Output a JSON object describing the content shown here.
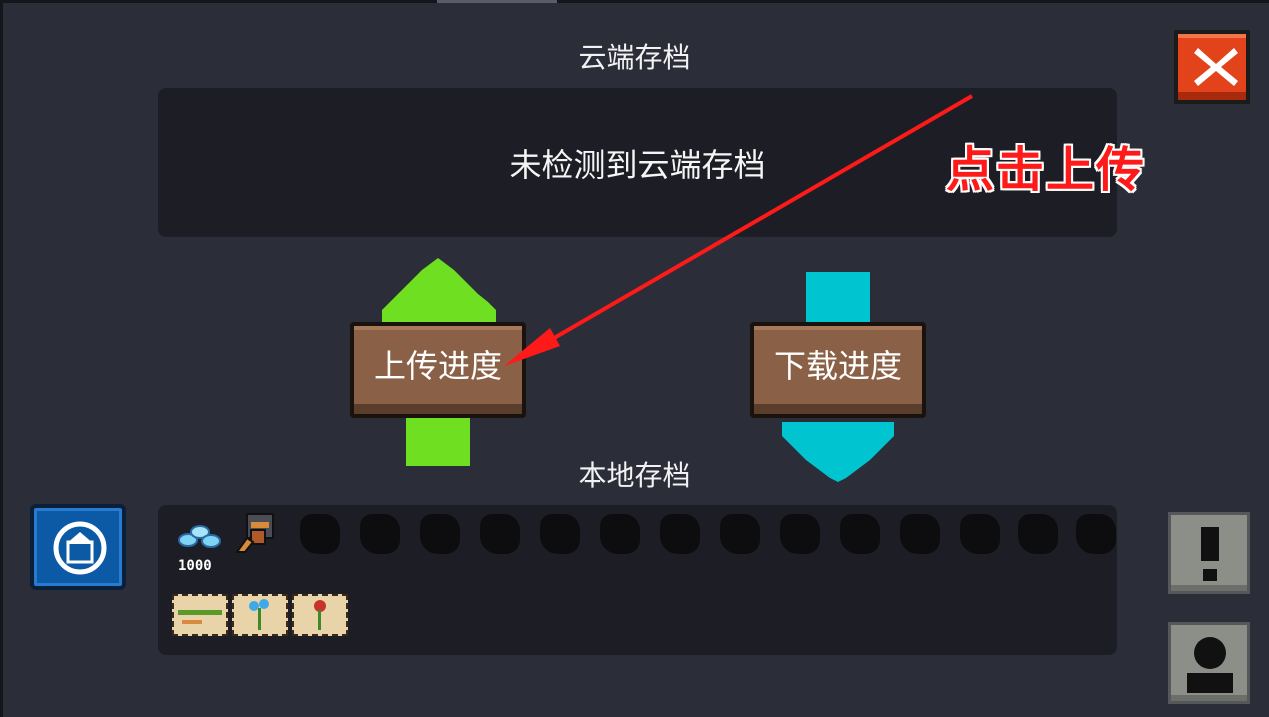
{
  "cloud": {
    "title": "云端存档",
    "status": "未检测到云端存档"
  },
  "actions": {
    "upload_label": "上传进度",
    "download_label": "下载进度"
  },
  "local": {
    "title": "本地存档",
    "gem_count": "1000"
  },
  "annotation": {
    "text": "点击上传"
  },
  "colors": {
    "upload_arrow": "#6ee021",
    "download_arrow": "#00c4cf",
    "close_button": "#e2431b",
    "annotation": "#ff1a1a"
  },
  "icons": {
    "close": "close-icon",
    "dome": "dome-icon",
    "alert": "exclamation-icon",
    "profile": "person-icon"
  }
}
